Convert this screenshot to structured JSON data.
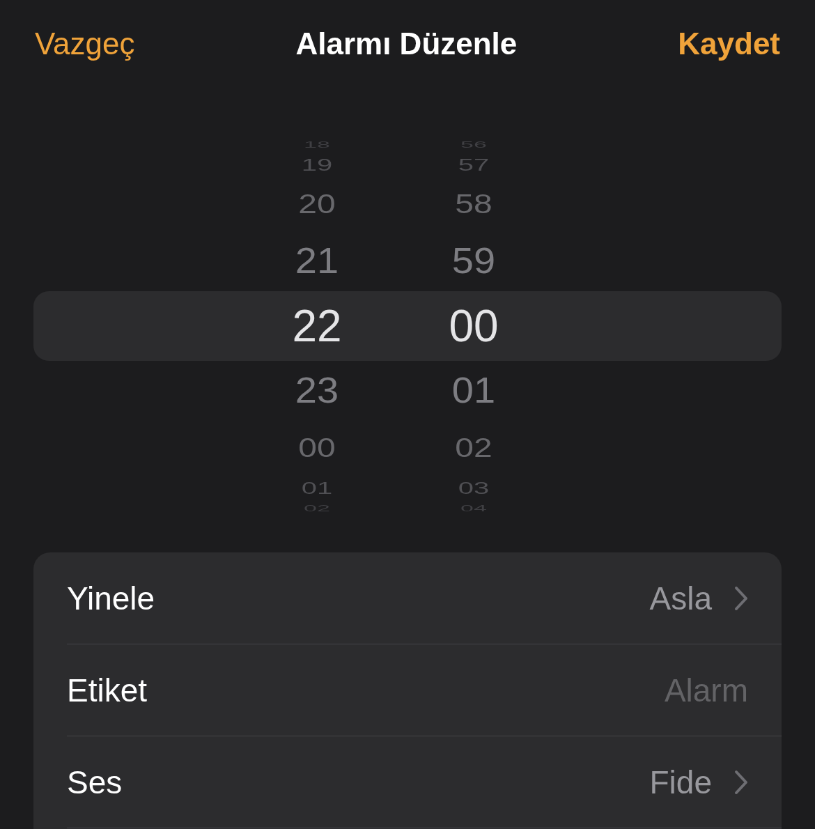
{
  "nav": {
    "cancel": "Vazgeç",
    "title": "Alarmı Düzenle",
    "save": "Kaydet"
  },
  "picker": {
    "rows": [
      {
        "hour": "18",
        "minute": "56",
        "selected": false
      },
      {
        "hour": "19",
        "minute": "57",
        "selected": false
      },
      {
        "hour": "20",
        "minute": "58",
        "selected": false
      },
      {
        "hour": "21",
        "minute": "59",
        "selected": false
      },
      {
        "hour": "22",
        "minute": "00",
        "selected": true
      },
      {
        "hour": "23",
        "minute": "01",
        "selected": false
      },
      {
        "hour": "00",
        "minute": "02",
        "selected": false
      },
      {
        "hour": "01",
        "minute": "03",
        "selected": false
      },
      {
        "hour": "02",
        "minute": "04",
        "selected": false
      }
    ]
  },
  "settings": [
    {
      "kind": "disclosure",
      "label": "Yinele",
      "value": "Asla"
    },
    {
      "kind": "field",
      "label": "Etiket",
      "placeholder": "Alarm"
    },
    {
      "kind": "disclosure",
      "label": "Ses",
      "value": "Fide"
    }
  ]
}
